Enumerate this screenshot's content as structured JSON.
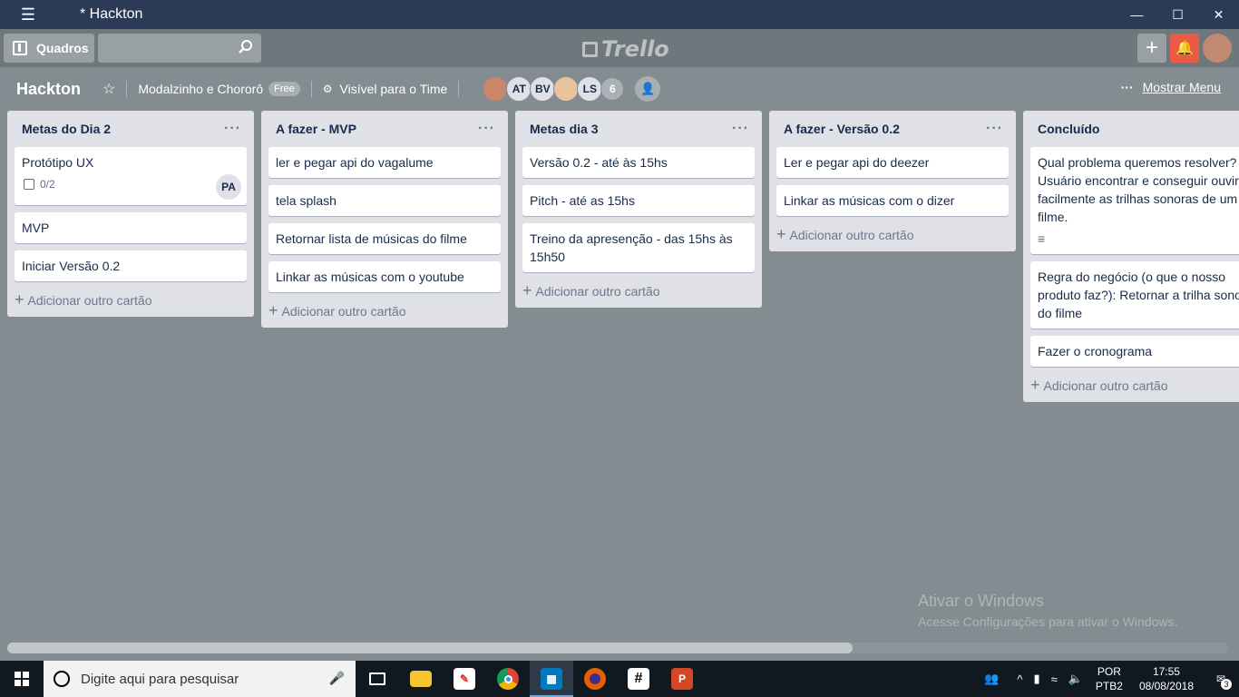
{
  "window": {
    "title": "* Hackton",
    "menu_icon": "hamburger-icon",
    "controls": [
      "minimize-icon",
      "maximize-icon",
      "close-icon"
    ]
  },
  "header": {
    "boards_label": "Quadros",
    "search_value": "",
    "logo_text": "Trello",
    "create_icon": "plus-icon",
    "notifications_icon": "bell-icon"
  },
  "board": {
    "title": "Hackton",
    "team": "Modalzinho e Chororô",
    "team_badge": "Free",
    "visibility": "Visível para o Time",
    "members": [
      "",
      "AT",
      "BV",
      "",
      "LS"
    ],
    "member_count": "6",
    "show_menu_label": "Mostrar Menu"
  },
  "lists": [
    {
      "title": "Metas do Dia 2",
      "cards": [
        {
          "text": "Protótipo UX",
          "checklist": "0/2",
          "member": "PA"
        },
        {
          "text": "MVP"
        },
        {
          "text": "Iniciar Versão 0.2"
        }
      ],
      "add_label": "Adicionar outro cartão"
    },
    {
      "title": "A fazer - MVP",
      "cards": [
        {
          "text": "ler e pegar api do vagalume"
        },
        {
          "text": "tela splash"
        },
        {
          "text": "Retornar lista de músicas do filme"
        },
        {
          "text": "Linkar as músicas com o youtube"
        }
      ],
      "add_label": "Adicionar outro cartão"
    },
    {
      "title": "Metas dia 3",
      "cards": [
        {
          "text": "Versão 0.2 - até às 15hs"
        },
        {
          "text": "Pitch - até as 15hs"
        },
        {
          "text": "Treino da apresenção - das 15hs às 15h50"
        }
      ],
      "add_label": "Adicionar outro cartão"
    },
    {
      "title": "A fazer - Versão 0.2",
      "cards": [
        {
          "text": "Ler e pegar api do deezer"
        },
        {
          "text": "Linkar as músicas com o dizer"
        }
      ],
      "add_label": "Adicionar outro cartão"
    },
    {
      "title": "Concluído",
      "cards": [
        {
          "text": "Qual problema queremos resolver? Usuário encontrar e conseguir ouvir facilmente as trilhas sonoras de um filme.",
          "has_description": true
        },
        {
          "text": "Regra do negócio (o que o nosso produto faz?): Retornar a trilha sonora do filme"
        },
        {
          "text": "Fazer o cronograma"
        }
      ],
      "add_label": "Adicionar outro cartão"
    }
  ],
  "watermark": {
    "line1": "Ativar o Windows",
    "line2": "Acesse Configurações para ativar o Windows."
  },
  "taskbar": {
    "search_placeholder": "Digite aqui para pesquisar",
    "apps": [
      "task-view-icon",
      "file-explorer-icon",
      "paint-icon",
      "chrome-icon",
      "trello-icon",
      "firefox-icon",
      "slack-icon",
      "powerpoint-icon"
    ],
    "lang_line1": "POR",
    "lang_line2": "PTB2",
    "time": "17:55",
    "date": "08/08/2018",
    "notification_count": "3"
  }
}
